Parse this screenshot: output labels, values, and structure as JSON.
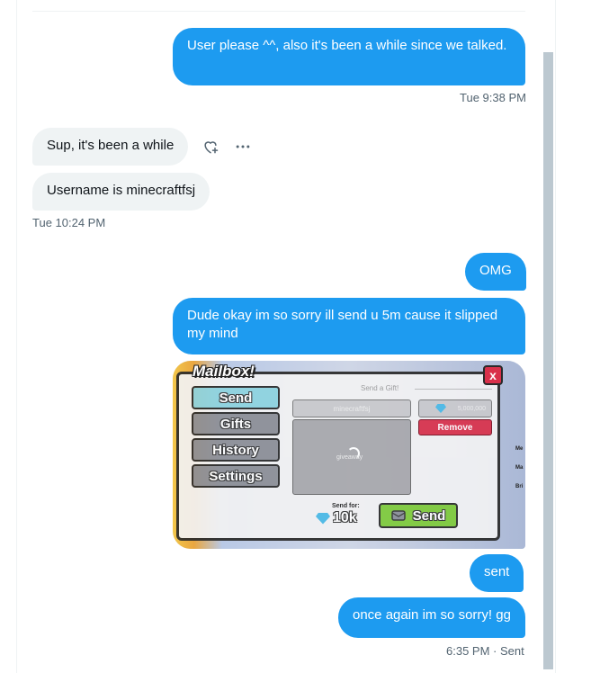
{
  "messages": [
    {
      "id": "m1",
      "direction": "out",
      "text": "User please ^^, also it's been a while since we talked."
    },
    {
      "id": "m2",
      "direction": "in",
      "text": "Sup, it's been a while"
    },
    {
      "id": "m3",
      "direction": "in",
      "text": "Username is minecraftfsj"
    },
    {
      "id": "m4",
      "direction": "out",
      "text": "OMG"
    },
    {
      "id": "m5",
      "direction": "out",
      "text": "Dude okay im so sorry ill send u 5m cause it slipped my mind"
    },
    {
      "id": "m6",
      "direction": "out",
      "text": "sent"
    },
    {
      "id": "m7",
      "direction": "out",
      "text": "once again im so sorry! gg"
    }
  ],
  "timestamps": {
    "first": "Tue 9:38 PM",
    "second": "Tue 10:24 PM",
    "last_time": "6:35 PM",
    "last_sep": "·",
    "last_status": "Sent"
  },
  "icons": {
    "react": "heart-plus-icon",
    "more": "more-horizontal-icon"
  },
  "colors": {
    "outgoing_bubble": "#1d9bf0",
    "incoming_bubble": "#eff3f4",
    "timestamp": "#536471"
  },
  "media": {
    "title": "Mailbox!",
    "close": "x",
    "tabs": [
      "Send",
      "Gifts",
      "History",
      "Settings"
    ],
    "send_a_gift": "Send a Gift!",
    "username": "minecraftfsj",
    "amount": "5,000,000",
    "remove": "Remove",
    "item": "giveaway",
    "send_for": "Send for:",
    "price": "10k",
    "send": "Send",
    "side_labels": [
      "Me",
      "Ma",
      "Bri"
    ]
  }
}
